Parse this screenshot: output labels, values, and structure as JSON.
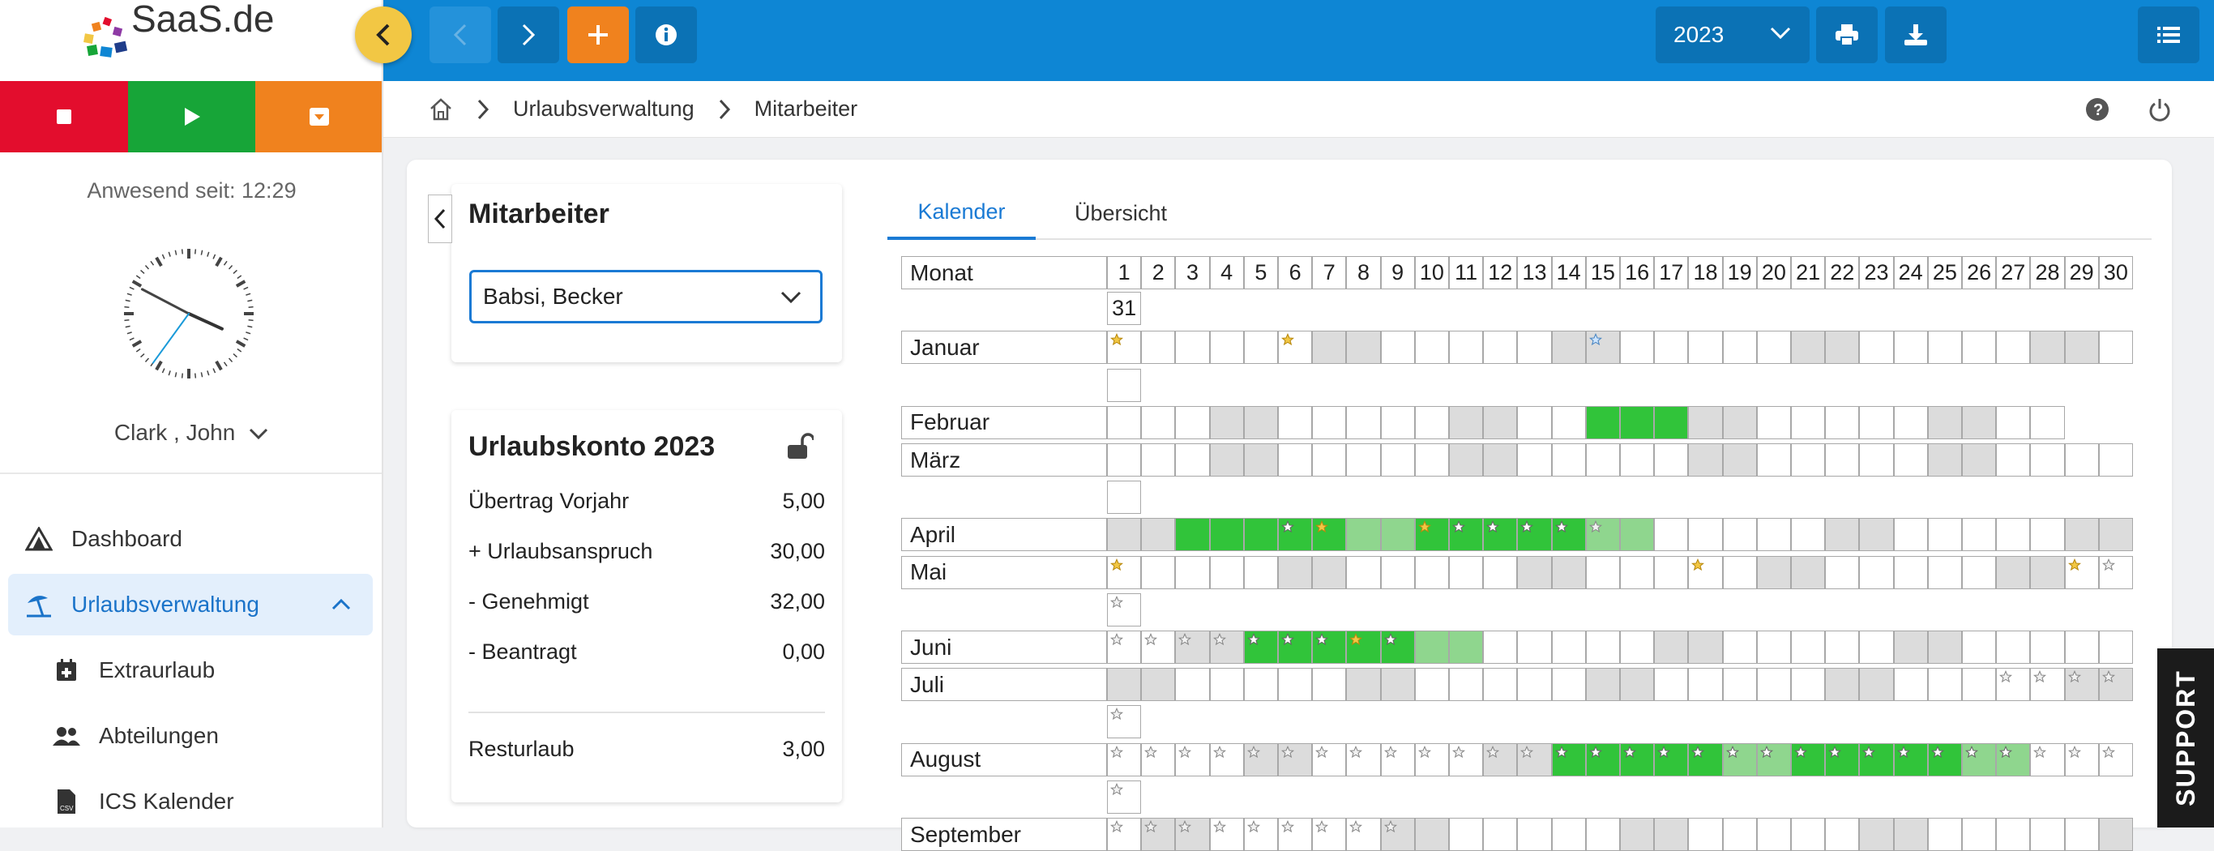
{
  "brand": {
    "name": "SaaS.de"
  },
  "sidebar": {
    "presence": "Anwesend seit: 12:29",
    "clock": {
      "hour": 3,
      "minute": 49,
      "second": 36
    },
    "user": "Clark , John",
    "nav": [
      {
        "label": "Dashboard",
        "icon": "dashboard-icon"
      },
      {
        "label": "Urlaubsverwaltung",
        "icon": "beach-umbrella-icon"
      },
      {
        "label": "Extraurlaub",
        "icon": "calendar-plus-icon"
      },
      {
        "label": "Abteilungen",
        "icon": "users-icon"
      },
      {
        "label": "ICS Kalender",
        "icon": "csv-file-icon"
      }
    ]
  },
  "colors": {
    "stop": "#e30d2d",
    "play": "#17a538",
    "orange": "#f0821e",
    "accent": "#0e86d4",
    "approved": "#31c43a",
    "pending": "#8fd68e",
    "weekend": "#dcdcdc"
  },
  "toolbar": {
    "year": "2023"
  },
  "breadcrumb": {
    "item1": "Urlaubsverwaltung",
    "item2": "Mitarbeiter"
  },
  "employee": {
    "title": "Mitarbeiter",
    "selected": "Babsi, Becker"
  },
  "account": {
    "title": "Urlaubskonto 2023",
    "rows": [
      {
        "label": "Übertrag Vorjahr",
        "value": "5,00"
      },
      {
        "label": "+ Urlaubsanspruch",
        "value": "30,00"
      },
      {
        "label": "- Genehmigt",
        "value": "32,00"
      },
      {
        "label": "- Beantragt",
        "value": "0,00"
      }
    ],
    "rest": {
      "label": "Resturlaub",
      "value": "3,00"
    }
  },
  "tabs": {
    "calendar": "Kalender",
    "overview": "Übersicht"
  },
  "calendar": {
    "header": "Monat",
    "days": [
      "1",
      "2",
      "3",
      "4",
      "5",
      "6",
      "7",
      "8",
      "9",
      "10",
      "11",
      "12",
      "13",
      "14",
      "15",
      "16",
      "17",
      "18",
      "19",
      "20",
      "21",
      "22",
      "23",
      "24",
      "25",
      "26",
      "27",
      "28",
      "29",
      "30",
      "31"
    ],
    "months": [
      {
        "name": "Januar",
        "days": 31,
        "weekend": [
          7,
          8,
          14,
          15,
          21,
          22,
          28,
          29
        ],
        "green": [],
        "light": [],
        "stars": {
          "1": "y",
          "6": "y",
          "15": "b"
        }
      },
      {
        "name": "Februar",
        "days": 28,
        "weekend": [
          4,
          5,
          11,
          12,
          18,
          19,
          25,
          26
        ],
        "green": [
          15,
          16,
          17
        ],
        "light": [],
        "stars": {}
      },
      {
        "name": "März",
        "days": 31,
        "weekend": [
          4,
          5,
          11,
          12,
          18,
          19,
          25,
          26
        ],
        "green": [],
        "light": [],
        "stars": {}
      },
      {
        "name": "April",
        "days": 30,
        "weekend": [
          1,
          2,
          8,
          9,
          15,
          16,
          22,
          23,
          29,
          30
        ],
        "green": [
          3,
          4,
          5,
          6,
          7,
          10,
          11,
          12,
          13,
          14
        ],
        "light": [
          8,
          9,
          15,
          16
        ],
        "stars": {
          "6": "w",
          "7": "y",
          "10": "y",
          "11": "w",
          "12": "w",
          "13": "w",
          "14": "w",
          "15": "g"
        }
      },
      {
        "name": "Mai",
        "days": 31,
        "weekend": [
          6,
          7,
          13,
          14,
          20,
          21,
          27,
          28
        ],
        "green": [],
        "light": [],
        "stars": {
          "1": "y",
          "18": "y",
          "29": "y",
          "30": "g",
          "31": "g"
        }
      },
      {
        "name": "Juni",
        "days": 30,
        "weekend": [
          3,
          4,
          10,
          11,
          17,
          18,
          24,
          25
        ],
        "green": [
          5,
          6,
          7,
          8,
          9
        ],
        "light": [
          10,
          11
        ],
        "stars": {
          "1": "g",
          "2": "g",
          "3": "g",
          "4": "g",
          "5": "w",
          "6": "w",
          "7": "w",
          "8": "y",
          "9": "w"
        }
      },
      {
        "name": "Juli",
        "days": 31,
        "weekend": [
          1,
          2,
          8,
          9,
          15,
          16,
          22,
          23,
          29,
          30
        ],
        "green": [],
        "light": [],
        "stars": {
          "27": "g",
          "28": "g",
          "29": "g",
          "30": "g",
          "31": "g"
        }
      },
      {
        "name": "August",
        "days": 31,
        "weekend": [
          5,
          6,
          12,
          13,
          19,
          20,
          26,
          27
        ],
        "green": [
          14,
          15,
          16,
          17,
          18,
          21,
          22,
          23,
          24,
          25
        ],
        "light": [
          19,
          20,
          26,
          27
        ],
        "stars": {
          "1": "g",
          "2": "g",
          "3": "g",
          "4": "g",
          "5": "g",
          "6": "g",
          "7": "g",
          "8": "g",
          "9": "g",
          "10": "g",
          "11": "g",
          "12": "g",
          "13": "g",
          "14": "w",
          "15": "w",
          "16": "w",
          "17": "w",
          "18": "w",
          "19": "w",
          "20": "w",
          "21": "w",
          "22": "w",
          "23": "w",
          "24": "w",
          "25": "w",
          "26": "w",
          "27": "w",
          "28": "g",
          "29": "g",
          "30": "g",
          "31": "g"
        }
      },
      {
        "name": "September",
        "days": 30,
        "weekend": [
          2,
          3,
          9,
          10,
          16,
          17,
          23,
          24,
          30
        ],
        "green": [],
        "light": [],
        "stars": {
          "1": "g",
          "2": "g",
          "3": "g",
          "4": "g",
          "5": "g",
          "6": "g",
          "7": "g",
          "8": "g",
          "9": "g"
        }
      }
    ]
  },
  "support": "SUPPORT"
}
